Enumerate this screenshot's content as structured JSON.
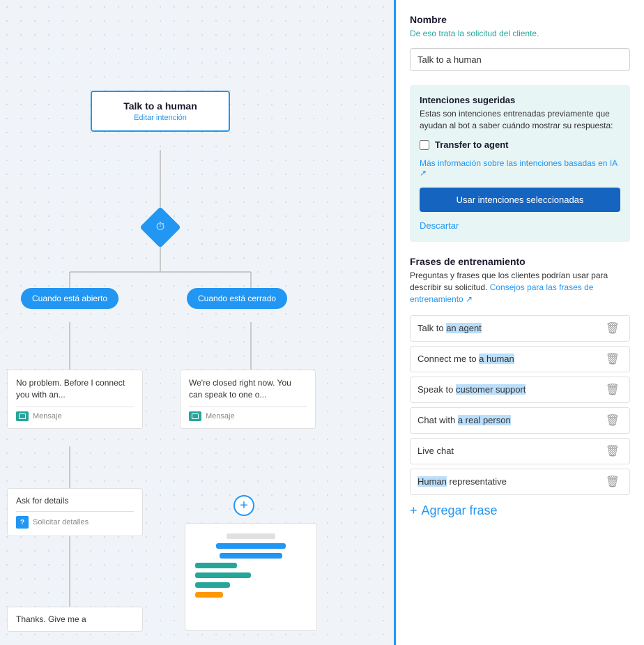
{
  "left": {
    "top_node": {
      "title": "Talk to a human",
      "subtitle": "Editar intención"
    },
    "branch_left": "Cuando está abierto",
    "branch_right": "Cuando está cerrado",
    "card_left_text": "No problem. Before I connect you with an...",
    "card_left_footer": "Mensaje",
    "card_right_text": "We're closed right now. You can speak to one o...",
    "card_right_footer": "Mensaje",
    "card_ask_title": "Ask for details",
    "card_ask_footer": "Solicitar detalles",
    "card_thanks_text": "Thanks. Give me a"
  },
  "right": {
    "nombre_section": {
      "title": "Nombre",
      "desc": "De eso trata la solicitud del cliente.",
      "input_value": "Talk to a human"
    },
    "suggested_section": {
      "title": "Intenciones sugeridas",
      "desc": "Estas son intenciones entrenadas previamente que ayudan al bot a saber cuándo mostrar su respuesta:",
      "checkbox_label": "Transfer to agent",
      "link_text": "Más información sobre las intenciones basadas en IA",
      "btn_use": "Usar intenciones seleccionadas",
      "btn_discard": "Descartar"
    },
    "training_section": {
      "title": "Frases de entrenamiento",
      "desc_start": "Preguntas y frases que los clientes podrían usar para describir su solicitud.",
      "desc_link": "Consejos para las frases de entrenamiento",
      "phrases": [
        {
          "id": 1,
          "text": "Talk to an agent",
          "highlight": "an agent"
        },
        {
          "id": 2,
          "text": "Connect me to a human",
          "highlight": "a human"
        },
        {
          "id": 3,
          "text": "Speak to customer support",
          "highlight": "customer support"
        },
        {
          "id": 4,
          "text": "Chat with a real person",
          "highlight": "a real person"
        },
        {
          "id": 5,
          "text": "Live chat",
          "highlight": ""
        },
        {
          "id": 6,
          "text": "Human representative",
          "highlight": "Human"
        }
      ],
      "add_label": "Agregar frase"
    }
  },
  "icons": {
    "clock": "⏱",
    "chat": "💬",
    "question": "?",
    "plus": "+",
    "trash": "🗑",
    "add": "+"
  }
}
